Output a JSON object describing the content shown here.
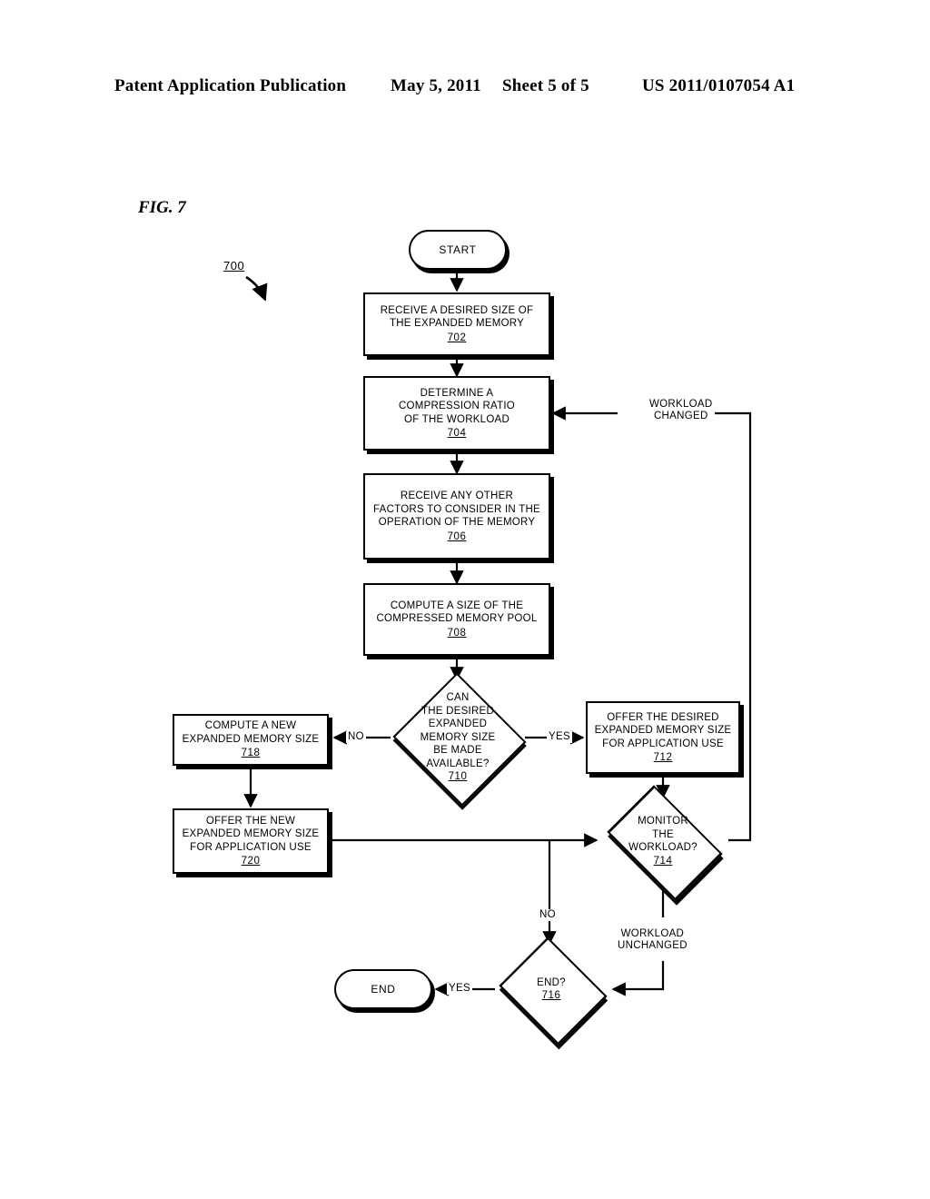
{
  "header": {
    "publication": "Patent Application Publication",
    "date": "May 5, 2011",
    "sheet": "Sheet 5 of 5",
    "number": "US 2011/0107054 A1"
  },
  "figure": {
    "label": "FIG. 7",
    "reference": "700"
  },
  "nodes": {
    "start": {
      "text": "START"
    },
    "end": {
      "text": "END"
    },
    "s702": {
      "text": "RECEIVE A DESIRED SIZE OF\nTHE EXPANDED MEMORY",
      "num": "702"
    },
    "s704": {
      "text": "DETERMINE A\nCOMPRESSION RATIO\nOF THE WORKLOAD",
      "num": "704"
    },
    "s706": {
      "text": "RECEIVE ANY OTHER\nFACTORS TO CONSIDER IN THE\nOPERATION OF THE MEMORY",
      "num": "706"
    },
    "s708": {
      "text": "COMPUTE A SIZE OF THE\nCOMPRESSED MEMORY POOL",
      "num": "708"
    },
    "s710": {
      "text": "CAN\nTHE DESIRED\nEXPANDED\nMEMORY SIZE\nBE MADE\nAVAILABLE?",
      "num": "710"
    },
    "s712": {
      "text": "OFFER THE DESIRED\nEXPANDED MEMORY SIZE\nFOR APPLICATION USE",
      "num": "712"
    },
    "s714": {
      "text": "MONITOR\nTHE\nWORKLOAD?",
      "num": "714"
    },
    "s716": {
      "text": "END?",
      "num": "716"
    },
    "s718": {
      "text": "COMPUTE A NEW\nEXPANDED MEMORY SIZE",
      "num": "718"
    },
    "s720": {
      "text": "OFFER THE NEW\nEXPANDED MEMORY SIZE\nFOR APPLICATION USE",
      "num": "720"
    }
  },
  "edges": {
    "no_710": "NO",
    "yes_710": "YES",
    "workload_changed": "WORKLOAD\nCHANGED",
    "workload_unchanged": "WORKLOAD\nUNCHANGED",
    "no_716": "NO",
    "yes_716": "YES"
  },
  "colors": {
    "ink": "#000000",
    "paper": "#ffffff"
  }
}
